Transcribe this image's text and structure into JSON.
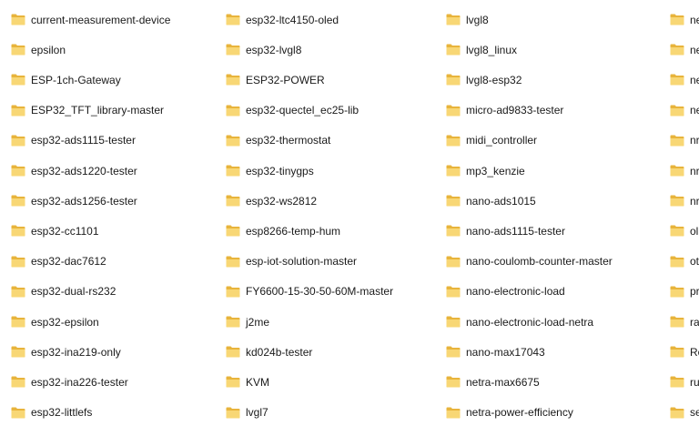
{
  "icons": {
    "folder": "folder-icon",
    "folder_back": "#e8b43c",
    "folder_front": "#f8d775"
  },
  "columns": [
    {
      "items": [
        "current-measurement-device",
        "epsilon",
        "ESP-1ch-Gateway",
        "ESP32_TFT_library-master",
        "esp32-ads1115-tester",
        "esp32-ads1220-tester",
        "esp32-ads1256-tester",
        "esp32-cc1101",
        "esp32-dac7612",
        "esp32-dual-rs232",
        "esp32-epsilon",
        "esp32-ina219-only",
        "esp32-ina226-tester",
        "esp32-littlefs"
      ]
    },
    {
      "items": [
        "esp32-ltc4150-oled",
        "esp32-lvgl8",
        "ESP32-POWER",
        "esp32-quectel_ec25-lib",
        "esp32-thermostat",
        "esp32-tinygps",
        "esp32-ws2812",
        "esp8266-temp-hum",
        "esp-iot-solution-master",
        "FY6600-15-30-50-60M-master",
        "j2me",
        "kd024b-tester",
        "KVM",
        "lvgl7"
      ]
    },
    {
      "items": [
        "lvgl8",
        "lvgl8_linux",
        "lvgl8-esp32",
        "micro-ad9833-tester",
        "midi_controller",
        "mp3_kenzie",
        "nano-ads1015",
        "nano-ads1115-tester",
        "nano-coulomb-counter-master",
        "nano-electronic-load",
        "nano-electronic-load-netra",
        "nano-max17043",
        "netra-max6675",
        "netra-power-efficiency"
      ]
    },
    {
      "items": [
        "ne",
        "ne",
        "ne",
        "ne",
        "nrf",
        "nrf",
        "nrf",
        "ol",
        "oti",
        "pro",
        "ras",
        "Ro",
        "rus",
        "ser"
      ]
    }
  ]
}
